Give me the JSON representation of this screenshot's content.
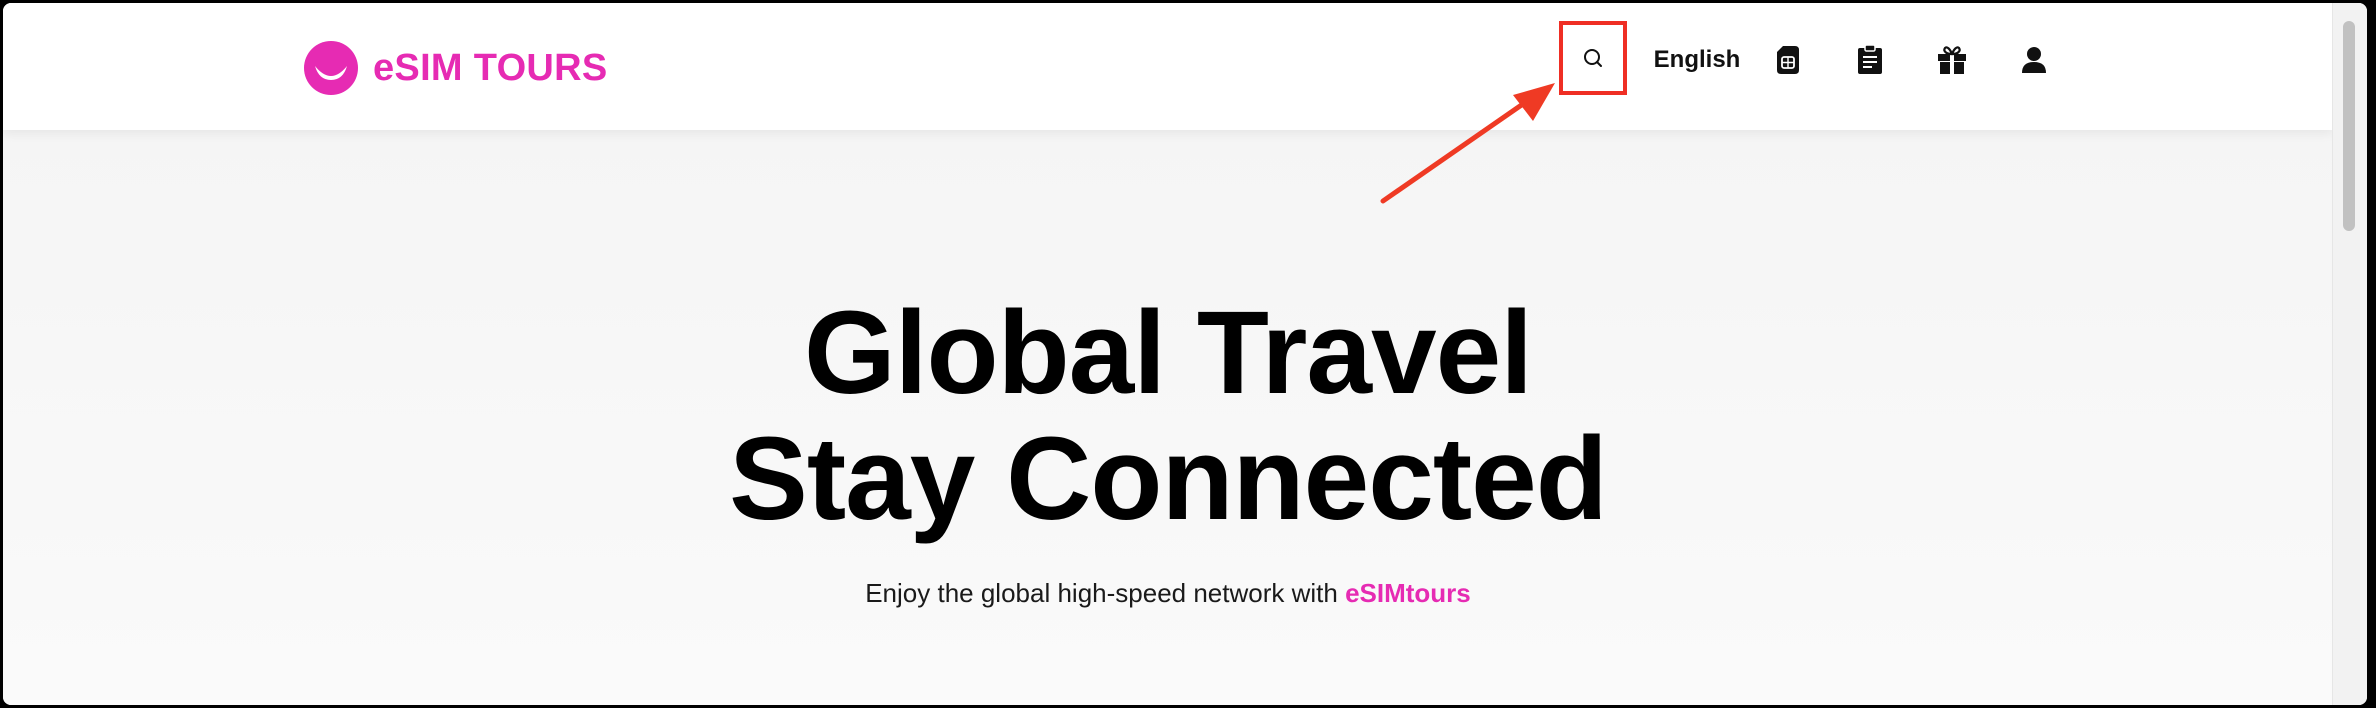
{
  "header": {
    "logo_text": "eSIM TOURS",
    "language": "English"
  },
  "hero": {
    "title_line1": "Global Travel",
    "title_line2": "Stay Connected",
    "subtitle_prefix": "Enjoy the global high-speed network with",
    "subtitle_brand": "eSIMtours"
  },
  "icons": {
    "logo": "smile-logo-icon",
    "search": "search-icon",
    "sim": "sim-card-icon",
    "orders": "clipboard-icon",
    "gift": "gift-icon",
    "account": "user-icon"
  },
  "colors": {
    "brand": "#e62bb3",
    "highlight": "#ef2e24",
    "text": "#111111"
  }
}
